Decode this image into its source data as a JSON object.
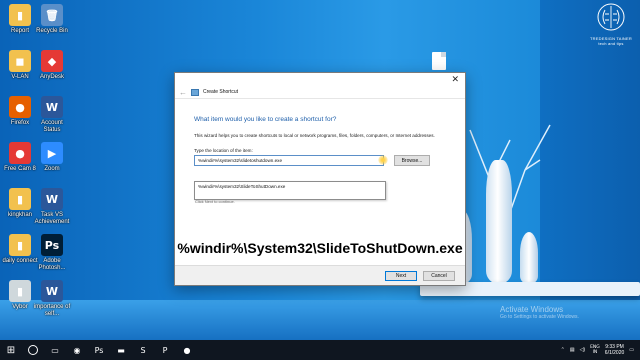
{
  "desktop": {
    "icons": [
      {
        "label": "Report",
        "name": "report-icon",
        "glyph": "▮",
        "color": "#f2c14e"
      },
      {
        "label": "Recycle Bin",
        "name": "recycle-bin-icon",
        "glyph": "🗑",
        "color": "#5a8fc9"
      },
      {
        "label": "V-LAN",
        "name": "vlan-icon",
        "glyph": "◼",
        "color": "#f2c14e"
      },
      {
        "label": "AnyDesk",
        "name": "anydesk-icon",
        "glyph": "◆",
        "color": "#e53935"
      },
      {
        "label": "Firefox",
        "name": "firefox-icon",
        "glyph": "●",
        "color": "#e66000"
      },
      {
        "label": "Account Status",
        "name": "account-status-icon",
        "glyph": "W",
        "color": "#2b579a"
      },
      {
        "label": "Free Cam 8",
        "name": "freecam-icon",
        "glyph": "●",
        "color": "#e53935"
      },
      {
        "label": "Zoom",
        "name": "zoom-icon",
        "glyph": "▶",
        "color": "#2d8cff"
      },
      {
        "label": "kingkhan",
        "name": "kingkhan-icon",
        "glyph": "▮",
        "color": "#f2c14e"
      },
      {
        "label": "Task VS Achievement",
        "name": "task-vs-achievement-icon",
        "glyph": "W",
        "color": "#2b579a"
      },
      {
        "label": "daily connect",
        "name": "daily-connect-icon",
        "glyph": "▮",
        "color": "#f2c14e"
      },
      {
        "label": "Adobe Photosh...",
        "name": "photoshop-icon",
        "glyph": "Ps",
        "color": "#001e36"
      },
      {
        "label": "Vybor",
        "name": "vybor-icon",
        "glyph": "▮",
        "color": "#cfd8dc"
      },
      {
        "label": "importance of self...",
        "name": "importance-icon",
        "glyph": "W",
        "color": "#2b579a"
      }
    ]
  },
  "logo": {
    "line1": "TREDESIGN TAINER",
    "line2": "tech and tips"
  },
  "dialog": {
    "title": "Create Shortcut",
    "close_glyph": "✕",
    "back_glyph": "←",
    "question": "What item would you like to create a shortcut for?",
    "description": "This wizard helps you to create shortcuts to local or network programs, files, folders, computers, or Internet addresses.",
    "location_label": "Type the location of the item:",
    "location_value": "%windir%\\system32\\slidetoshutdown.exe",
    "browse_label": "Browse...",
    "suggestion": "%windir%\\system32\\SlideToShutDown.exe",
    "ghost_text": "Click Next to continue.",
    "next_label": "Next",
    "cancel_label": "Cancel"
  },
  "caption": "%windir%\\System32\\SlideToShutDown.exe",
  "watermark": {
    "line1": "Activate Windows",
    "line2": "Go to Settings to activate Windows."
  },
  "taskbar": {
    "start_glyph": "⊞",
    "apps": [
      {
        "name": "task-view-icon",
        "glyph": "▭"
      },
      {
        "name": "chrome-icon",
        "glyph": "◉"
      },
      {
        "name": "photoshop-taskbar-icon",
        "glyph": "Ps"
      },
      {
        "name": "file-explorer-icon",
        "glyph": "▬"
      },
      {
        "name": "sublime-icon",
        "glyph": "S"
      },
      {
        "name": "powerpoint-icon",
        "glyph": "P"
      },
      {
        "name": "recorder-icon",
        "glyph": "●"
      }
    ],
    "language": "ENG",
    "region": "IN",
    "time": "9:33 PM",
    "date": "6/1/2020"
  }
}
